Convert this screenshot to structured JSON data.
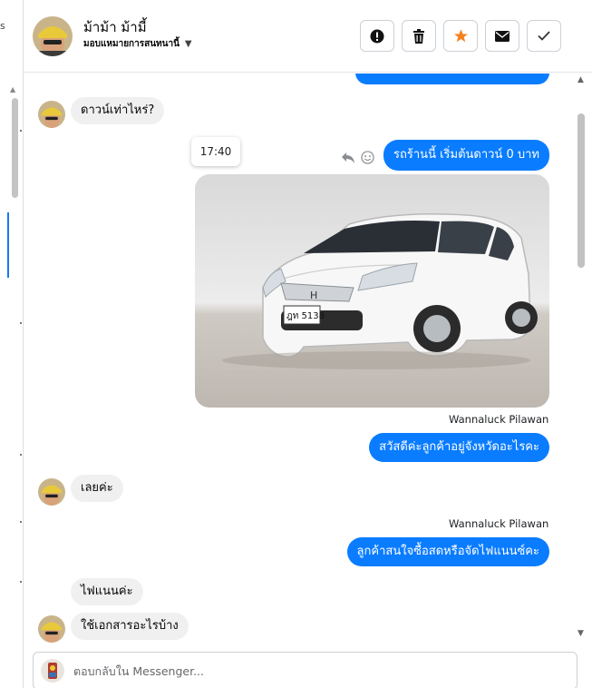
{
  "left_panel": {
    "fragment": "s"
  },
  "header": {
    "name": "ม้าม้า ม้ามี้",
    "assign_label": "มอบแหมายการสนทนานี้",
    "actions": [
      {
        "icon": "alert-icon",
        "title": "spam"
      },
      {
        "icon": "trash-icon",
        "title": "delete"
      },
      {
        "icon": "star-icon",
        "title": "follow-up"
      },
      {
        "icon": "envelope-icon",
        "title": "mark-unread"
      },
      {
        "icon": "check-icon",
        "title": "done"
      }
    ]
  },
  "messages": {
    "m1": {
      "text": "ดาวน์เท่าไหร่?"
    },
    "time_tooltip": "17:40",
    "m2": {
      "text": "รถร้านนี้ เริ่มต้นดาวน์ 0 บาท"
    },
    "photo": {
      "plate": "ฎท 5138"
    },
    "m3": {
      "sender": "Wannaluck Pilawan",
      "text": "สวัสดีค่ะลูกค้าอยู่จังหวัดอะไรคะ"
    },
    "m4": {
      "text": "เลยค่ะ"
    },
    "m5": {
      "sender": "Wannaluck Pilawan",
      "text": "ลูกค้าสนใจซื้อสดหรือจัดไฟแนนซ์คะ"
    },
    "m6": {
      "text": "ไฟแนนค่ะ"
    },
    "m7": {
      "text": "ใช้เอกสารอะไรบ้าง"
    }
  },
  "composer": {
    "placeholder": "ตอบกลับใน Messenger..."
  },
  "colors": {
    "outgoing": "#0a7cff",
    "incoming": "#f0f0f0",
    "star": "#f5821f"
  }
}
